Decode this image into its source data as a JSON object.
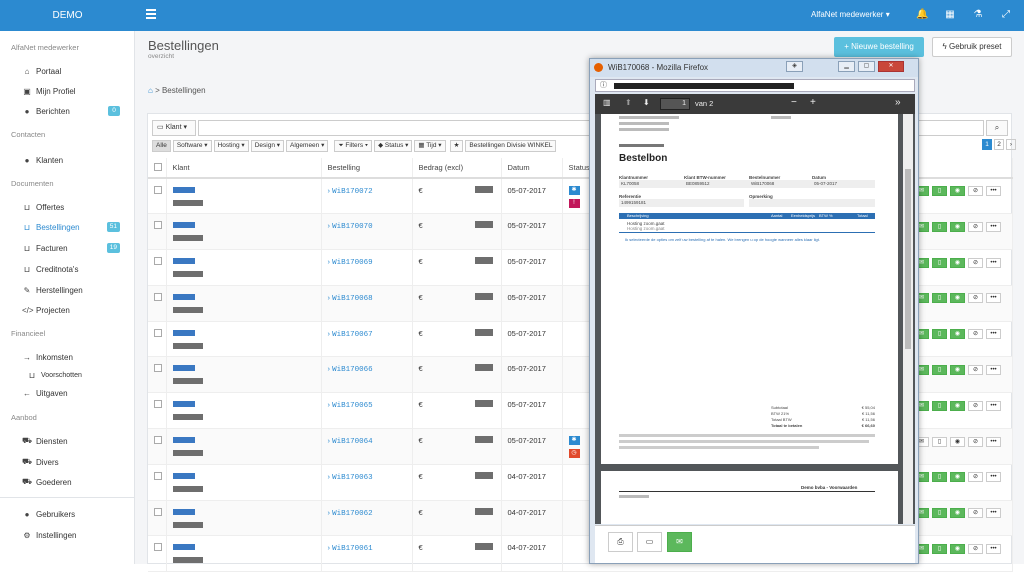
{
  "topbar": {
    "brand": "DEMO",
    "user": "AlfaNet medewerker"
  },
  "sidebar": {
    "sections": [
      "AlfaNet medewerker",
      "Contacten",
      "Documenten",
      "Financieel",
      "Aanbod"
    ],
    "items": [
      {
        "label": "Portaal",
        "icon": "home-icon"
      },
      {
        "label": "Mijn Profiel",
        "icon": "profile-icon"
      },
      {
        "label": "Berichten",
        "icon": "chat-icon",
        "badge": "0"
      },
      {
        "label": "Klanten",
        "icon": "user-icon"
      },
      {
        "label": "Offertes",
        "icon": "inbox-icon"
      },
      {
        "label": "Bestellingen",
        "icon": "inbox-icon",
        "badge": "51",
        "active": true
      },
      {
        "label": "Facturen",
        "icon": "inbox-icon",
        "badge": "19"
      },
      {
        "label": "Creditnota's",
        "icon": "inbox-icon"
      },
      {
        "label": "Herstellingen",
        "icon": "wrench-icon"
      },
      {
        "label": "Projecten",
        "icon": "code-icon"
      },
      {
        "label": "Inkomsten",
        "icon": "arrow-right-icon"
      },
      {
        "label": "Voorschotten",
        "icon": "inbox-icon"
      },
      {
        "label": "Uitgaven",
        "icon": "arrow-left-icon"
      },
      {
        "label": "Diensten",
        "icon": "cart-icon"
      },
      {
        "label": "Divers",
        "icon": "cart-icon"
      },
      {
        "label": "Goederen",
        "icon": "cart-icon"
      },
      {
        "label": "Gebruikers",
        "icon": "user-icon"
      },
      {
        "label": "Instellingen",
        "icon": "gear-icon"
      }
    ]
  },
  "header": {
    "title": "Bestellingen",
    "subtitle": "overzicht",
    "new_btn": "Nieuwe bestelling",
    "preset_btn": "Gebruik preset"
  },
  "breadcrumb": {
    "current": "Bestellingen"
  },
  "toolbar": {
    "klant": "Klant",
    "filters": [
      "Alle",
      "Software",
      "Hosting",
      "Design",
      "Algemeen",
      "Filters",
      "Status",
      "Tijd",
      "Bestellingen Divisie WINKEL"
    ],
    "pages": [
      "1",
      "2"
    ]
  },
  "table": {
    "headers": [
      "Klant",
      "Bestelling",
      "Bedrag (excl)",
      "Datum",
      "Status"
    ],
    "rows": [
      {
        "order": "WiB170072",
        "currency": "€",
        "date": "05-07-2017"
      },
      {
        "order": "WiB170070",
        "currency": "€",
        "date": "05-07-2017"
      },
      {
        "order": "WiB170069",
        "currency": "€",
        "date": "05-07-2017"
      },
      {
        "order": "WiB170068",
        "currency": "€",
        "date": "05-07-2017"
      },
      {
        "order": "WiB170067",
        "currency": "€",
        "date": "05-07-2017"
      },
      {
        "order": "WiB170066",
        "currency": "€",
        "date": "05-07-2017"
      },
      {
        "order": "WiB170065",
        "currency": "€",
        "date": "05-07-2017"
      },
      {
        "order": "WiB170064",
        "currency": "€",
        "date": "05-07-2017"
      },
      {
        "order": "WiB170063",
        "currency": "€",
        "date": "04-07-2017"
      },
      {
        "order": "WiB170062",
        "currency": "€",
        "date": "04-07-2017"
      },
      {
        "order": "WiB170061",
        "currency": "€",
        "date": "04-07-2017"
      }
    ]
  },
  "firefox": {
    "title": "WiB170068 - Mozilla Firefox",
    "page_num": "1",
    "page_of": "van 2",
    "doc": {
      "title": "Bestelbon",
      "fields": [
        "Klantnummer",
        "Klant BTW-nummer",
        "Bestelnummer",
        "Datum",
        "Referentie",
        "Opmerking"
      ],
      "values": [
        "KL70058",
        "BE0859512",
        "WiB170068",
        "05-07-2017",
        "1499159181",
        ""
      ],
      "table_headers": [
        "Beschrijving",
        "Aantal",
        "Eenheidsprijs",
        "BTW %",
        "Totaal"
      ],
      "line": "Hosting zoom.gaat",
      "line_sub": "Hosting zoom.gaat",
      "note": "Ik selecteerde de opties om zelf uw bestelling af te halen. We brengen u op de hoogte wanneer alles klaar ligt.",
      "totals": [
        [
          "Subtotaal",
          "€ 55,04"
        ],
        [
          "BTW 21%",
          "€ 11,56"
        ],
        [
          "Totaal BTW",
          "€ 11,56"
        ],
        [
          "Totaal te betalen",
          "€ 66,60"
        ]
      ],
      "footer_title": "Demo bvba - Voorwaarden"
    }
  }
}
